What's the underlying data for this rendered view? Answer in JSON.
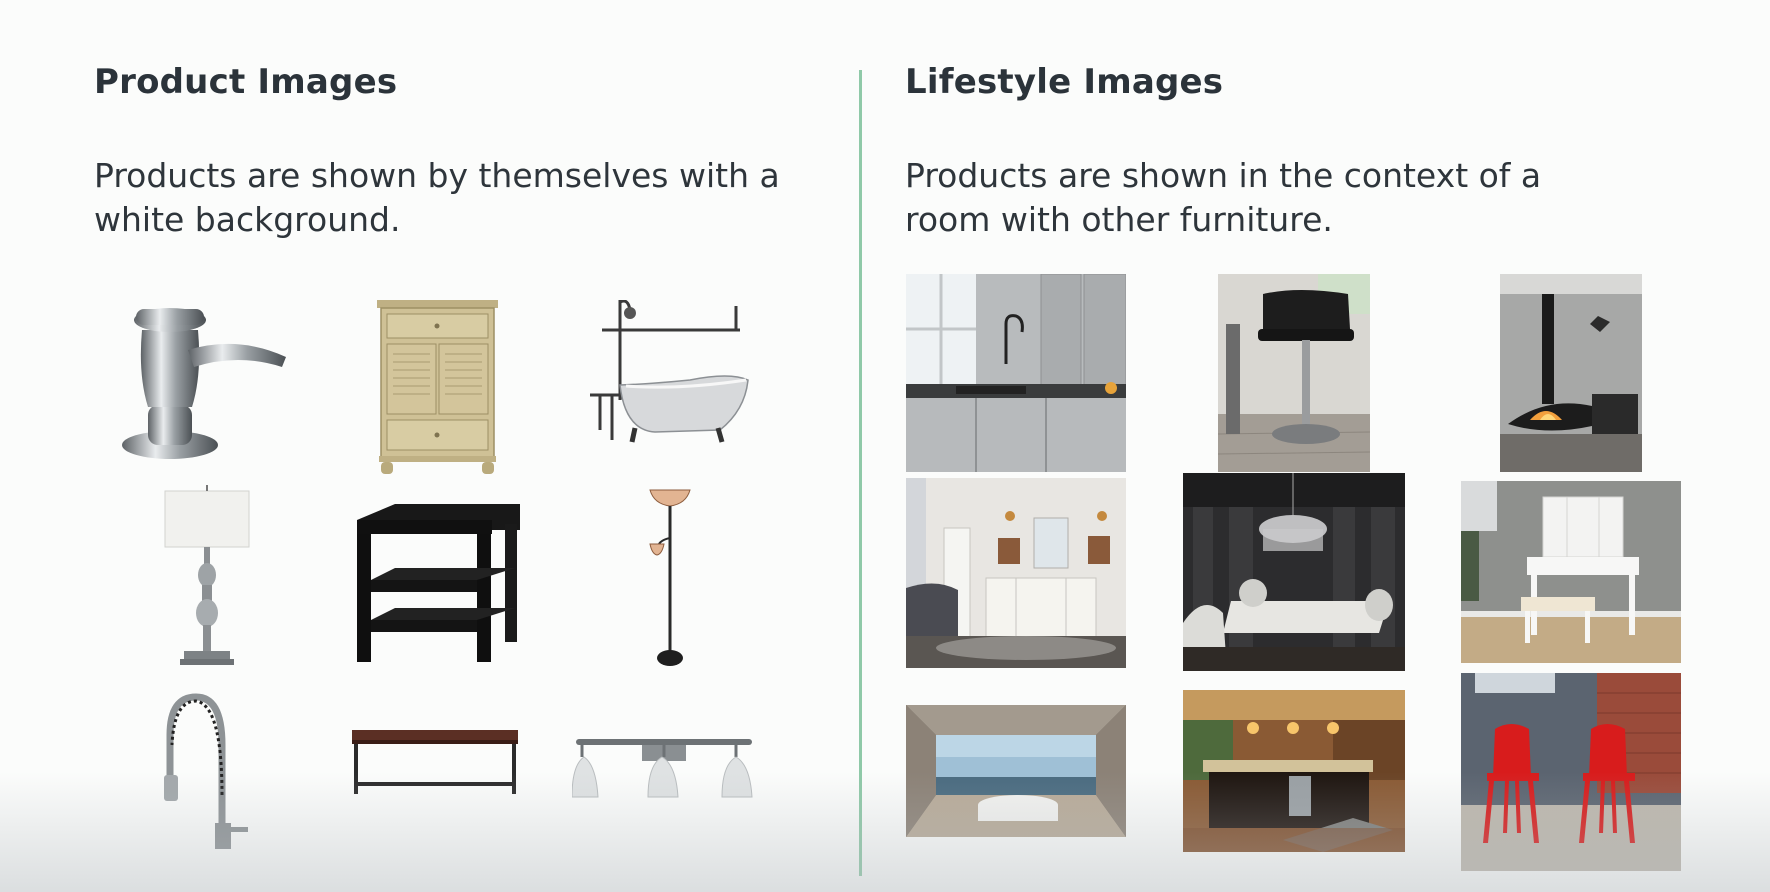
{
  "left": {
    "title": "Product Images",
    "description": "Products are shown by themselves with a white background.",
    "items": [
      "soap-dispenser",
      "bathroom-vanity-cabinet",
      "clawfoot-tub-with-shower",
      "table-lamp",
      "end-table",
      "floor-lamp",
      "kitchen-faucet",
      "bench",
      "vanity-light-fixture"
    ]
  },
  "right": {
    "title": "Lifestyle Images",
    "description": "Products are shown in the context of a room with other furniture.",
    "items": [
      "kitchen-sink-room",
      "bar-stool-room",
      "hanging-fireplace-room",
      "bathroom-vanity-room",
      "dining-chandelier-room",
      "makeup-vanity-room",
      "freestanding-tub-room",
      "kitchen-island-room",
      "red-chairs-room"
    ]
  },
  "colors": {
    "divider": "#8fc9a8",
    "text": "#2b333a",
    "background": "#fbfcfb"
  }
}
